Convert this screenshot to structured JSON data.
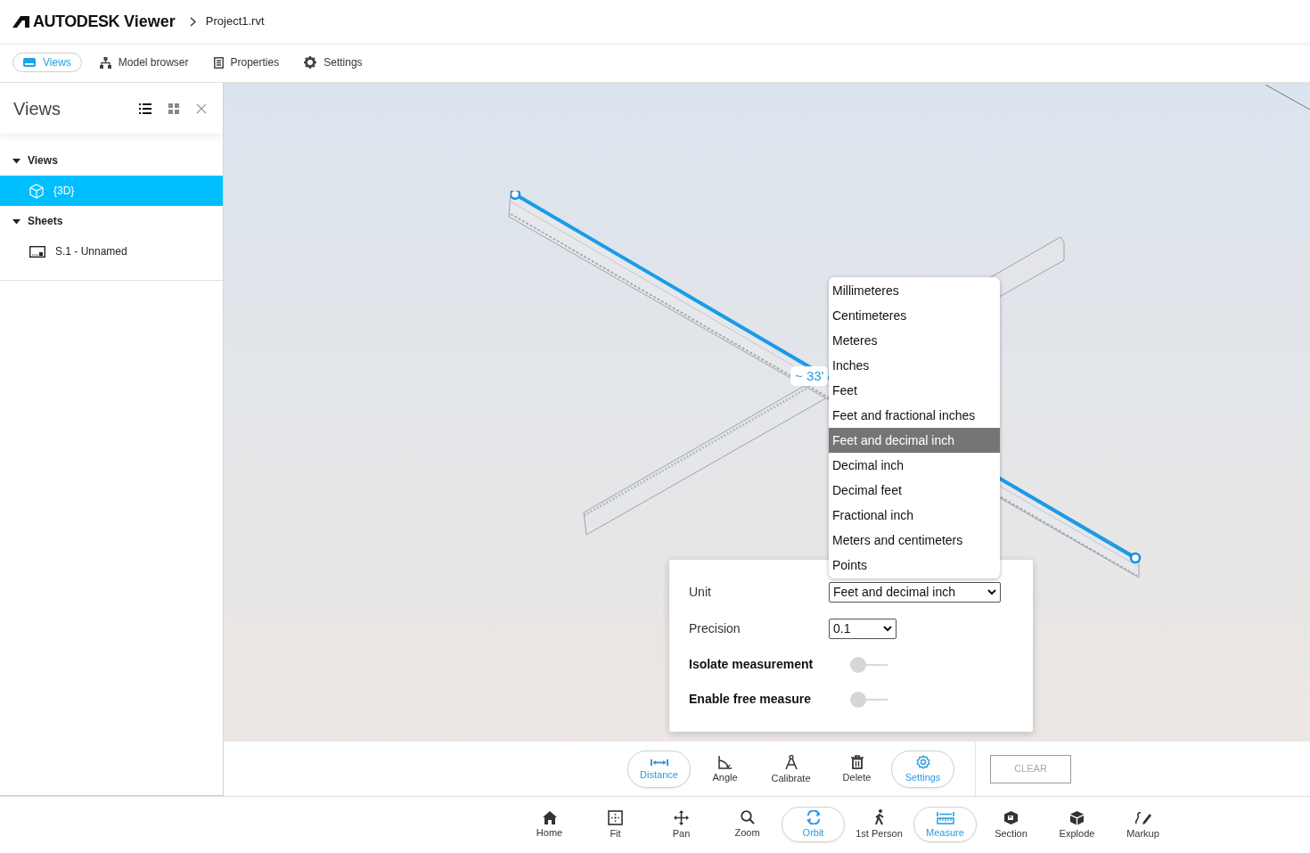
{
  "header": {
    "brand": "AUTODESK",
    "product": "Viewer",
    "file": "Project1.rvt"
  },
  "tabs": [
    {
      "label": "Views",
      "selected": true
    },
    {
      "label": "Model browser",
      "selected": false
    },
    {
      "label": "Properties",
      "selected": false
    },
    {
      "label": "Settings",
      "selected": false
    }
  ],
  "panel": {
    "title": "Views",
    "tree": [
      {
        "label": "Views",
        "expanded": true,
        "selected": false,
        "children": [
          {
            "label": "{3D}",
            "kind": "view",
            "selected": true
          }
        ]
      },
      {
        "label": "Sheets",
        "expanded": true,
        "selected": false,
        "children": [
          {
            "label": "S.1 - Unnamed",
            "kind": "sheet",
            "selected": false
          }
        ]
      }
    ]
  },
  "measurement": {
    "label": "~ 33'"
  },
  "unit_dropdown": {
    "options": [
      {
        "label": "Millimeteres",
        "selected": false
      },
      {
        "label": "Centimeteres",
        "selected": false
      },
      {
        "label": "Meteres",
        "selected": false
      },
      {
        "label": "Inches",
        "selected": false
      },
      {
        "label": "Feet",
        "selected": false
      },
      {
        "label": "Feet and fractional inches",
        "selected": false
      },
      {
        "label": "Feet and decimal inch",
        "selected": true
      },
      {
        "label": "Decimal inch",
        "selected": false
      },
      {
        "label": "Decimal feet",
        "selected": false
      },
      {
        "label": "Fractional inch",
        "selected": false
      },
      {
        "label": "Meters and centimeters",
        "selected": false
      },
      {
        "label": "Points",
        "selected": false
      }
    ]
  },
  "measure_settings": {
    "unit": {
      "label": "Unit",
      "value": "Feet and decimal inch"
    },
    "precision": {
      "label": "Precision",
      "value": "0.1"
    },
    "toggles": [
      {
        "label": "Isolate measurement",
        "on": false
      },
      {
        "label": "Enable free measure",
        "on": false
      }
    ]
  },
  "measure_toolbar": {
    "tools": [
      {
        "label": "Distance",
        "selected": true
      },
      {
        "label": "Angle",
        "selected": false
      },
      {
        "label": "Calibrate",
        "selected": false
      },
      {
        "label": "Delete",
        "selected": false
      },
      {
        "label": "Settings",
        "selected": true
      }
    ],
    "clear": {
      "label": "CLEAR",
      "disabled": true
    }
  },
  "main_toolbar": [
    {
      "label": "Home",
      "selected": false
    },
    {
      "label": "Fit",
      "selected": false
    },
    {
      "label": "Pan",
      "selected": false
    },
    {
      "label": "Zoom",
      "selected": false
    },
    {
      "label": "Orbit",
      "selected": true
    },
    {
      "label": "1st Person",
      "selected": false
    },
    {
      "label": "Measure",
      "selected": true
    },
    {
      "label": "Section",
      "selected": false
    },
    {
      "label": "Explode",
      "selected": false
    },
    {
      "label": "Markup",
      "selected": false
    }
  ]
}
